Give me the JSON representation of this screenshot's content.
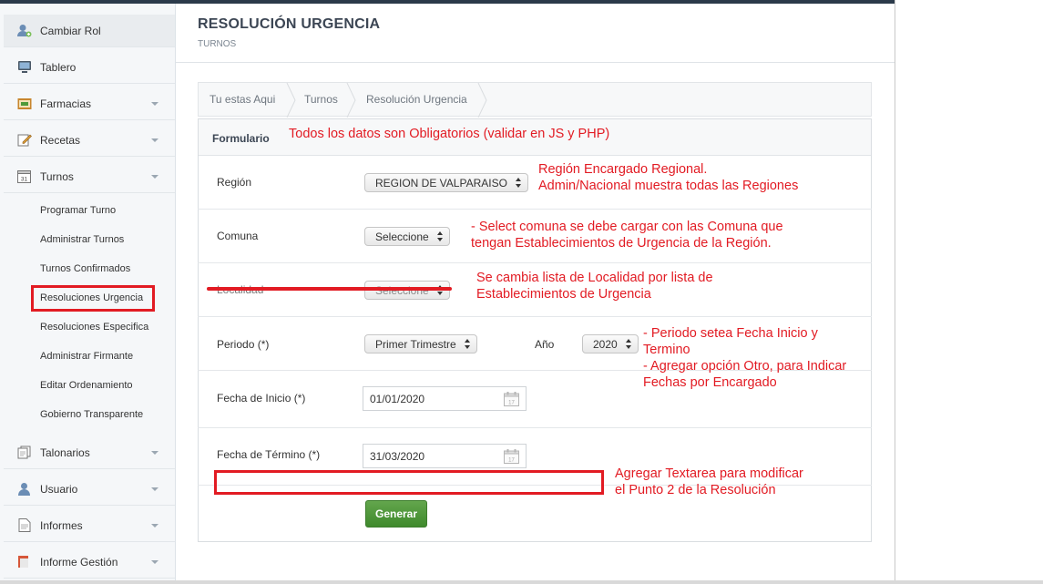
{
  "sidebar": {
    "items": [
      {
        "label": "Cambiar Rol",
        "icon": "user-switch-icon"
      },
      {
        "label": "Tablero",
        "icon": "monitor-icon"
      },
      {
        "label": "Farmacias",
        "icon": "pharmacy-icon"
      },
      {
        "label": "Recetas",
        "icon": "edit-icon"
      },
      {
        "label": "Turnos",
        "icon": "calendar-icon"
      },
      {
        "label": "Talonarios",
        "icon": "copy-icon"
      },
      {
        "label": "Usuario",
        "icon": "user-icon"
      },
      {
        "label": "Informes",
        "icon": "document-icon"
      },
      {
        "label": "Informe Gestión",
        "icon": "book-icon"
      }
    ],
    "turnos_submenu": [
      "Programar Turno",
      "Administrar Turnos",
      "Turnos Confirmados",
      "Resoluciones Urgencia",
      "Resoluciones Especifica",
      "Administrar Firmante",
      "Editar Ordenamiento",
      "Gobierno Transparente"
    ]
  },
  "header": {
    "title": "RESOLUCIÓN URGENCIA",
    "subtitle": "TURNOS"
  },
  "breadcrumb": [
    "Tu estas Aqui",
    "Turnos",
    "Resolución Urgencia"
  ],
  "form": {
    "panel_title": "Formulario",
    "region": {
      "label": "Región",
      "value": "REGION DE VALPARAISO"
    },
    "comuna": {
      "label": "Comuna",
      "value": "Seleccione"
    },
    "localidad": {
      "label": "Localidad",
      "value": "Seleccione"
    },
    "periodo": {
      "label": "Periodo (*)",
      "value": "Primer Trimestre"
    },
    "anio": {
      "label": "Año",
      "value": "2020"
    },
    "fecha_inicio": {
      "label": "Fecha de Inicio (*)",
      "value": "01/01/2020"
    },
    "fecha_termino": {
      "label": "Fecha de Término (*)",
      "value": "31/03/2020"
    },
    "submit_label": "Generar"
  },
  "annotations": {
    "panel_note": "Todos los datos son Obligatorios (validar en JS y PHP)",
    "region_note": [
      "Región Encargado Regional.",
      "Admin/Nacional muestra todas las Regiones"
    ],
    "comuna_note": [
      "- Select comuna se debe cargar con las Comuna que",
      "tengan Establecimientos de Urgencia de la Región."
    ],
    "localidad_note": [
      "Se cambia lista de Localidad por lista de",
      "Establecimientos de Urgencia"
    ],
    "periodo_note": [
      "- Periodo setea Fecha Inicio y",
      "Termino",
      "- Agregar opción Otro, para Indicar",
      "Fechas por Encargado"
    ],
    "textarea_note": [
      "Agregar Textarea para modificar",
      "el Punto 2 de la Resolución"
    ]
  },
  "colors": {
    "annotation_red": "#e21b23",
    "button_green": "#4f9a3a",
    "title_text": "#3c4654"
  }
}
